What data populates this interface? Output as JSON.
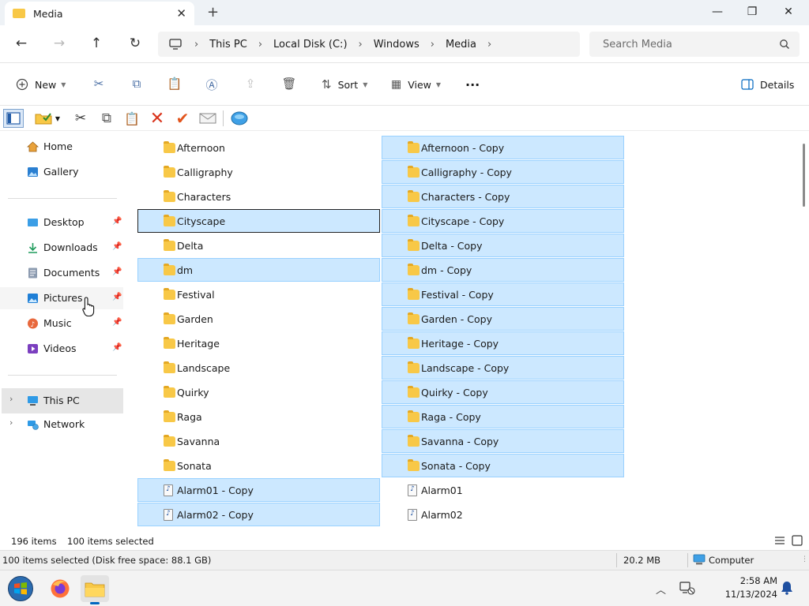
{
  "window": {
    "tab_title": "Media",
    "new_tab_symbol": "+",
    "minimize_symbol": "—",
    "maximize_symbol": "❐",
    "close_symbol": "✕",
    "tab_close_symbol": "✕"
  },
  "navigation": {
    "back_symbol": "←",
    "forward_symbol": "→",
    "up_symbol": "↑",
    "refresh_symbol": "↻",
    "breadcrumb": [
      "This PC",
      "Local Disk (C:)",
      "Windows",
      "Media"
    ],
    "breadcrumb_separator": "›",
    "search_placeholder": "Search Media"
  },
  "commandbar": {
    "new_label": "New",
    "sort_label": "Sort",
    "view_label": "View",
    "more_symbol": "···",
    "details_label": "Details",
    "icons": [
      "cut-icon",
      "copy-icon",
      "paste-icon",
      "rename-icon",
      "share-icon",
      "delete-icon"
    ]
  },
  "legacy_toolbar": {
    "icons": [
      "preview-pane-icon",
      "properties-icon",
      "cut-icon",
      "copy-icon",
      "paste-icon",
      "delete-icon",
      "checkmark-icon",
      "email-icon",
      "network-icon"
    ]
  },
  "sidebar": {
    "items": [
      {
        "label": "Home",
        "icon": "home-icon",
        "pinned": false
      },
      {
        "label": "Gallery",
        "icon": "gallery-icon",
        "pinned": false
      },
      {
        "label": "Desktop",
        "icon": "desktop-icon",
        "pinned": true
      },
      {
        "label": "Downloads",
        "icon": "downloads-icon",
        "pinned": true
      },
      {
        "label": "Documents",
        "icon": "documents-icon",
        "pinned": true
      },
      {
        "label": "Pictures",
        "icon": "pictures-icon",
        "pinned": true
      },
      {
        "label": "Music",
        "icon": "music-icon",
        "pinned": true
      },
      {
        "label": "Videos",
        "icon": "videos-icon",
        "pinned": true
      },
      {
        "label": "This PC",
        "icon": "this-pc-icon",
        "pinned": false,
        "expandable": true,
        "selected": true
      },
      {
        "label": "Network",
        "icon": "network-icon",
        "pinned": false,
        "expandable": true
      }
    ],
    "pin_symbol": "📌",
    "expand_symbol": "›"
  },
  "files": {
    "column1": [
      {
        "name": "Afternoon",
        "type": "folder",
        "selected": false
      },
      {
        "name": "Calligraphy",
        "type": "folder",
        "selected": false
      },
      {
        "name": "Characters",
        "type": "folder",
        "selected": false
      },
      {
        "name": "Cityscape",
        "type": "folder",
        "selected": true,
        "focused": true
      },
      {
        "name": "Delta",
        "type": "folder",
        "selected": false
      },
      {
        "name": "dm",
        "type": "folder",
        "selected": true
      },
      {
        "name": "Festival",
        "type": "folder",
        "selected": false
      },
      {
        "name": "Garden",
        "type": "folder",
        "selected": false
      },
      {
        "name": "Heritage",
        "type": "folder",
        "selected": false
      },
      {
        "name": "Landscape",
        "type": "folder",
        "selected": false
      },
      {
        "name": "Quirky",
        "type": "folder",
        "selected": false
      },
      {
        "name": "Raga",
        "type": "folder",
        "selected": false
      },
      {
        "name": "Savanna",
        "type": "folder",
        "selected": false
      },
      {
        "name": "Sonata",
        "type": "folder",
        "selected": false
      },
      {
        "name": "Alarm01 - Copy",
        "type": "audio",
        "selected": true
      },
      {
        "name": "Alarm02 - Copy",
        "type": "audio",
        "selected": true
      }
    ],
    "column2": [
      {
        "name": "Afternoon - Copy",
        "type": "folder",
        "selected": true
      },
      {
        "name": "Calligraphy - Copy",
        "type": "folder",
        "selected": true
      },
      {
        "name": "Characters - Copy",
        "type": "folder",
        "selected": true
      },
      {
        "name": "Cityscape - Copy",
        "type": "folder",
        "selected": true
      },
      {
        "name": "Delta - Copy",
        "type": "folder",
        "selected": true
      },
      {
        "name": "dm - Copy",
        "type": "folder",
        "selected": true
      },
      {
        "name": "Festival - Copy",
        "type": "folder",
        "selected": true
      },
      {
        "name": "Garden - Copy",
        "type": "folder",
        "selected": true
      },
      {
        "name": "Heritage - Copy",
        "type": "folder",
        "selected": true
      },
      {
        "name": "Landscape - Copy",
        "type": "folder",
        "selected": true
      },
      {
        "name": "Quirky - Copy",
        "type": "folder",
        "selected": true
      },
      {
        "name": "Raga - Copy",
        "type": "folder",
        "selected": true
      },
      {
        "name": "Savanna - Copy",
        "type": "folder",
        "selected": true
      },
      {
        "name": "Sonata - Copy",
        "type": "folder",
        "selected": true
      },
      {
        "name": "Alarm01",
        "type": "audio",
        "selected": false
      },
      {
        "name": "Alarm02",
        "type": "audio",
        "selected": false
      }
    ]
  },
  "status": {
    "item_count": "196 items",
    "selected_count": "100 items selected",
    "status_text": "100 items selected (Disk free space: 88.1 GB)",
    "size": "20.2 MB",
    "zone": "Computer"
  },
  "taskbar": {
    "apps": [
      "start-orb-icon",
      "firefox-icon",
      "file-explorer-icon"
    ],
    "tray": [
      "chevron-up-icon",
      "network-status-icon",
      "notifications-bell-icon"
    ],
    "time": "2:58 AM",
    "date": "11/13/2024"
  },
  "colors": {
    "selection_bg": "#cce8ff",
    "selection_border": "#99d1ff",
    "folder": "#f8c847",
    "accent": "#0067c0"
  }
}
